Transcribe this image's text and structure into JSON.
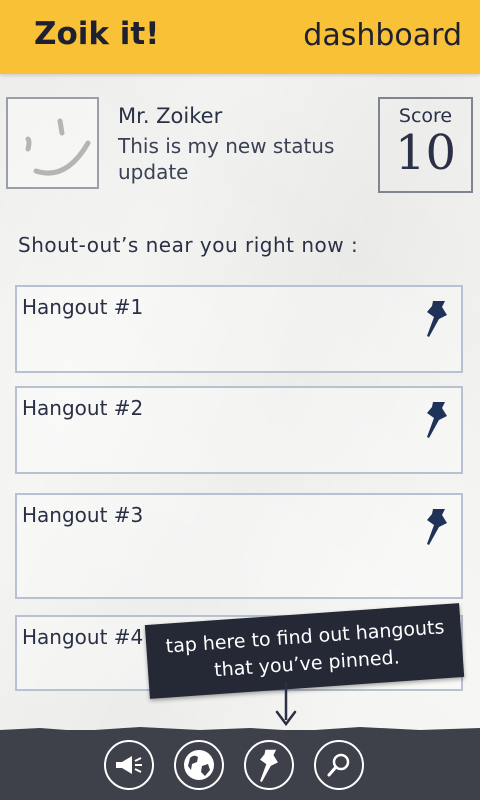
{
  "header": {
    "title": "Zoik it!",
    "nav": "dashboard"
  },
  "profile": {
    "name": "Mr. Zoiker",
    "status": "This is my new status update"
  },
  "score": {
    "label": "Score",
    "value": "10"
  },
  "section": {
    "heading": "Shout-out’s near you right now :"
  },
  "hangouts": [
    {
      "label": "Hangout #1"
    },
    {
      "label": "Hangout #2"
    },
    {
      "label": "Hangout #3"
    },
    {
      "label": "Hangout #4"
    }
  ],
  "tooltip": {
    "text": "tap here to find out hangouts that you’ve pinned."
  },
  "appbar": {
    "buttons": [
      {
        "icon": "megaphone-icon"
      },
      {
        "icon": "globe-icon"
      },
      {
        "icon": "pin-icon"
      },
      {
        "icon": "search-icon"
      }
    ]
  },
  "colors": {
    "header": "#f9c136",
    "ink": "#2a3046",
    "appbar": "#3e4149",
    "tooltip": "#252935"
  }
}
